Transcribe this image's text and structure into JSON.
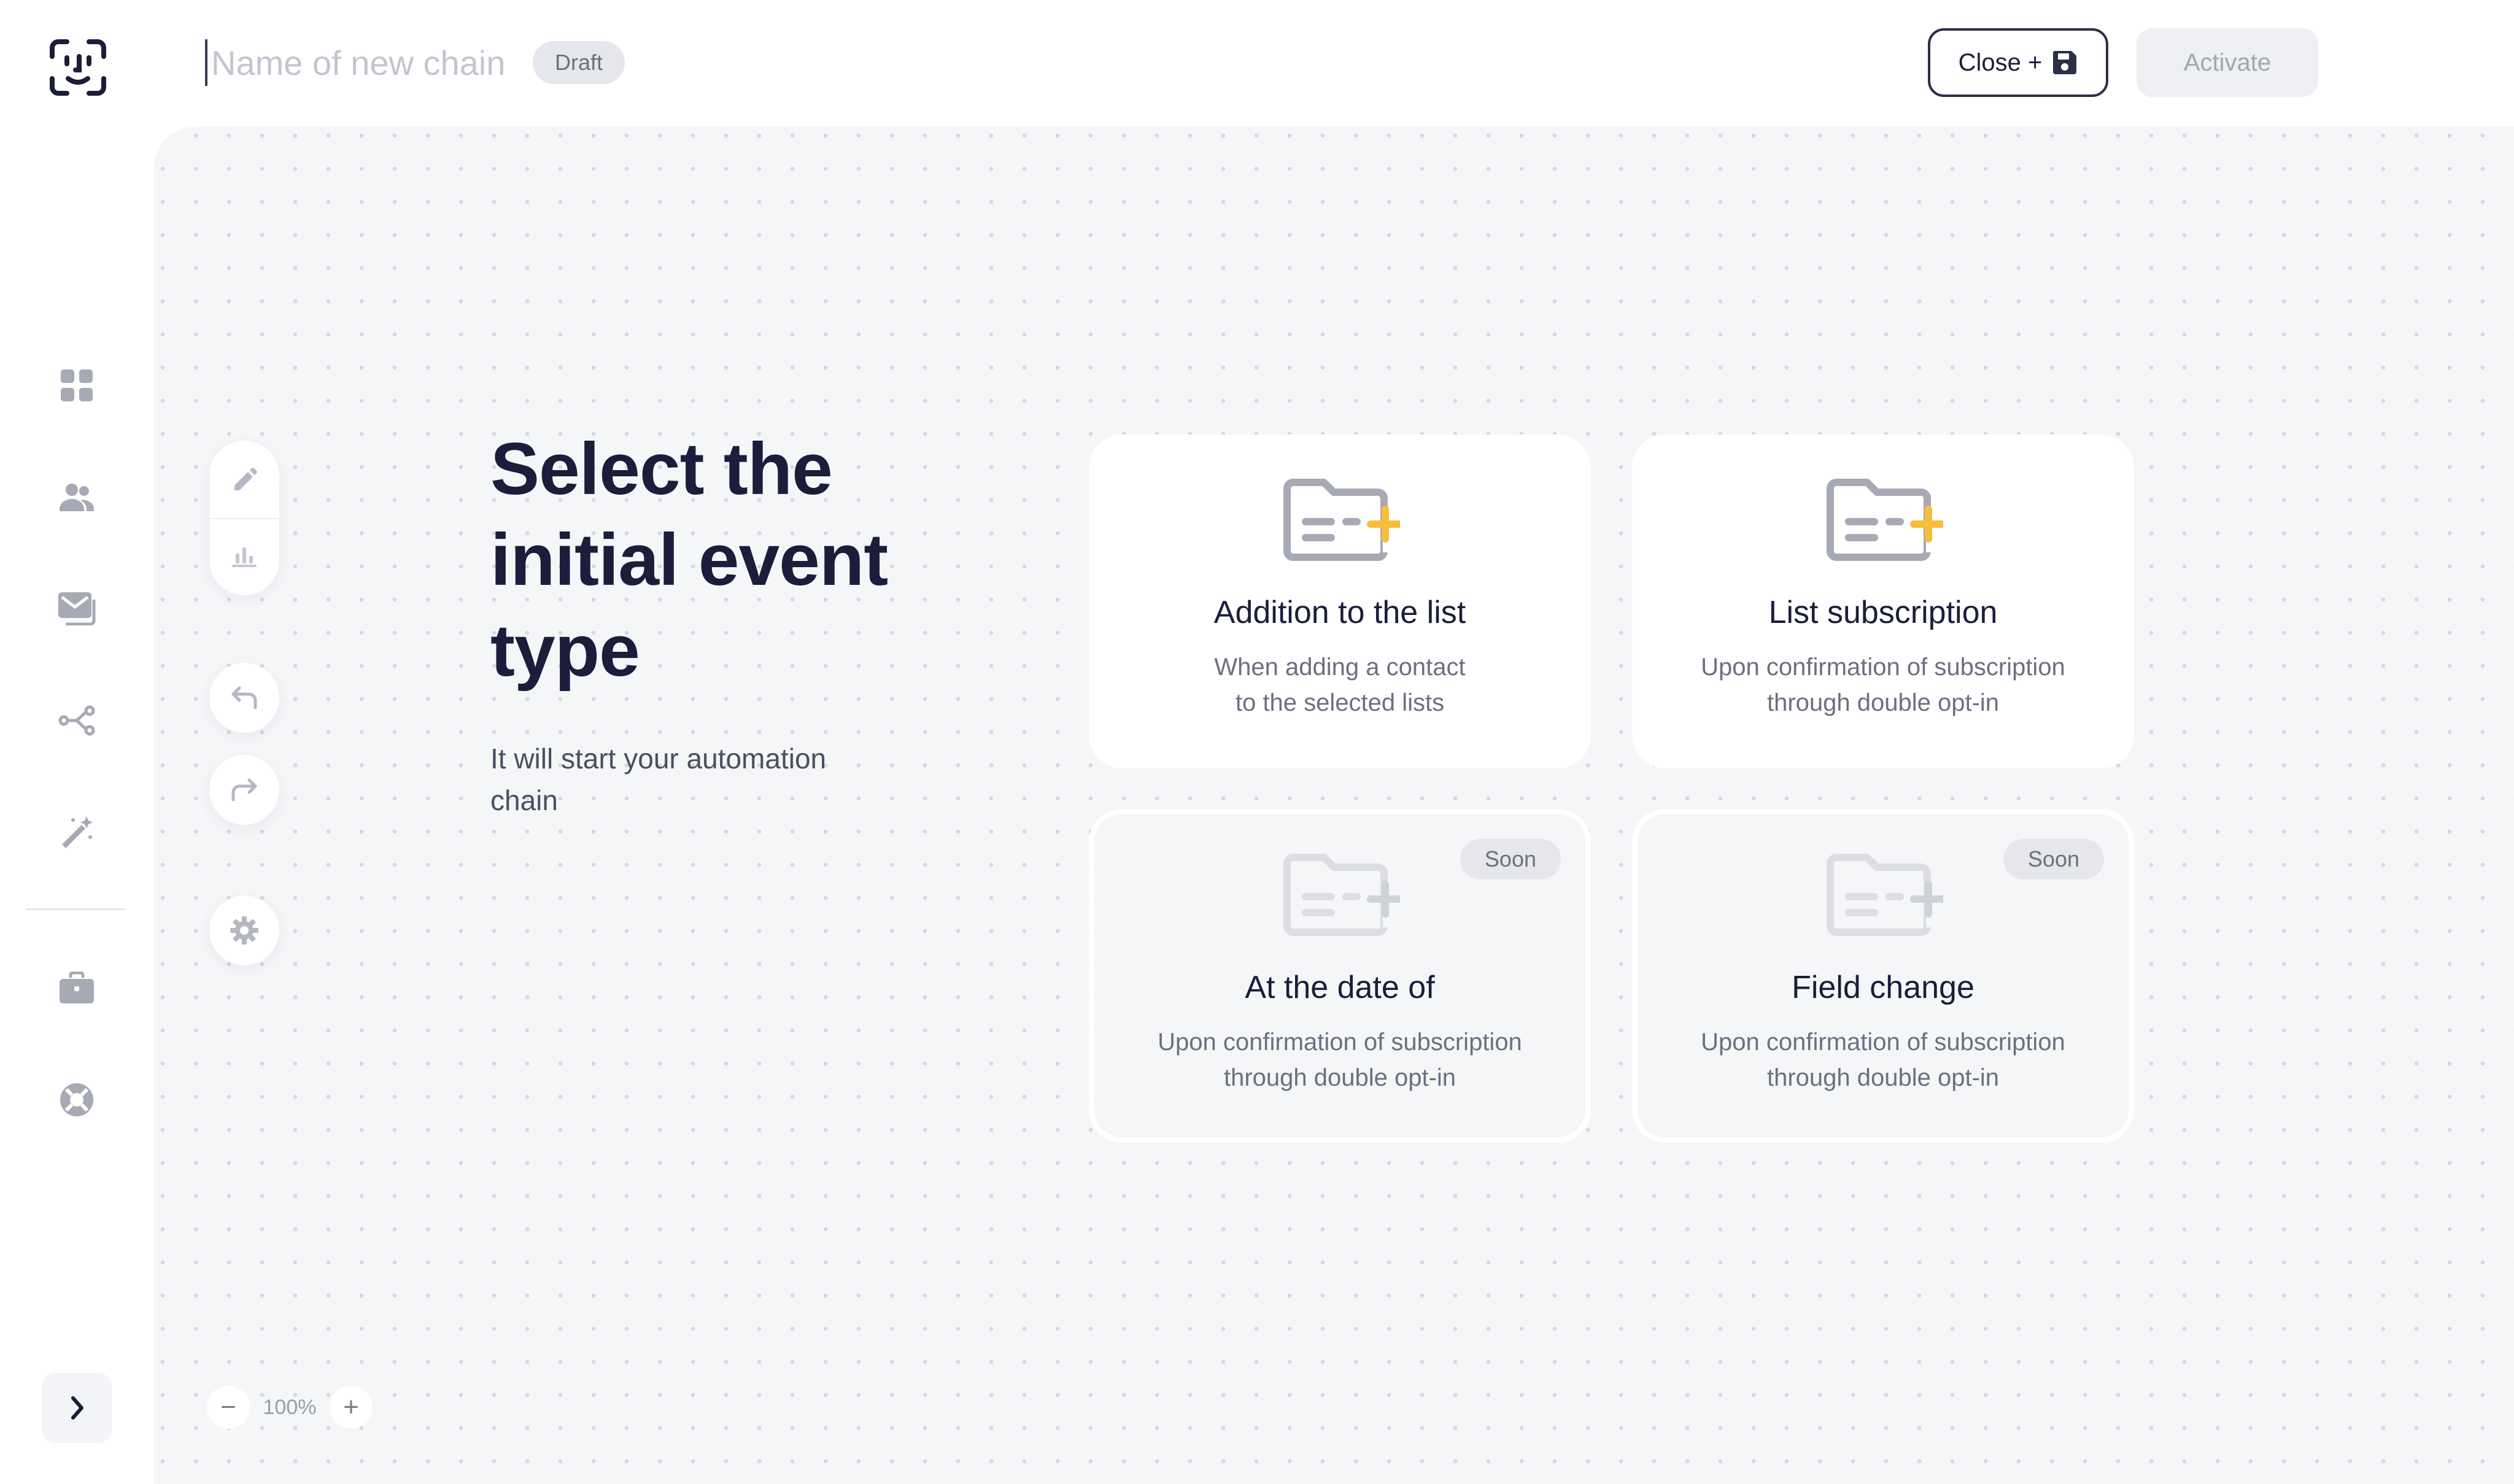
{
  "header": {
    "name_placeholder": "Name of new chain",
    "status_badge": "Draft",
    "close_label": "Close +",
    "activate_label": "Activate"
  },
  "sidebar": {
    "icons": [
      "face-id-logo-icon",
      "dashboard-icon",
      "contacts-icon",
      "mail-icon",
      "automation-icon",
      "magic-wand-icon",
      "briefcase-icon",
      "support-icon",
      "chevron-right-icon"
    ]
  },
  "main": {
    "heading": "Select the initial event type",
    "subheading": "It will start your automation chain",
    "cards": [
      {
        "title": "Addition to the list",
        "desc_line1": "When adding a contact",
        "desc_line2": "to the selected lists",
        "enabled": true
      },
      {
        "title": "List subscription",
        "desc_line1": "Upon confirmation of subscription",
        "desc_line2": "through double opt-in",
        "enabled": true
      },
      {
        "title": "At the date of",
        "desc_line1": "Upon confirmation of subscription",
        "desc_line2": "through double opt-in",
        "enabled": false,
        "badge": "Soon"
      },
      {
        "title": "Field change",
        "desc_line1": "Upon confirmation of subscription",
        "desc_line2": "through double opt-in",
        "enabled": false,
        "badge": "Soon"
      }
    ]
  },
  "zoom": {
    "minus": "−",
    "level": "100%",
    "plus": "+"
  },
  "colors": {
    "accent": "#f7bd3c",
    "text_dark": "#1b1d3a",
    "icon_gray": "#a7a9b5",
    "canvas_bg": "#f5f6f8"
  }
}
